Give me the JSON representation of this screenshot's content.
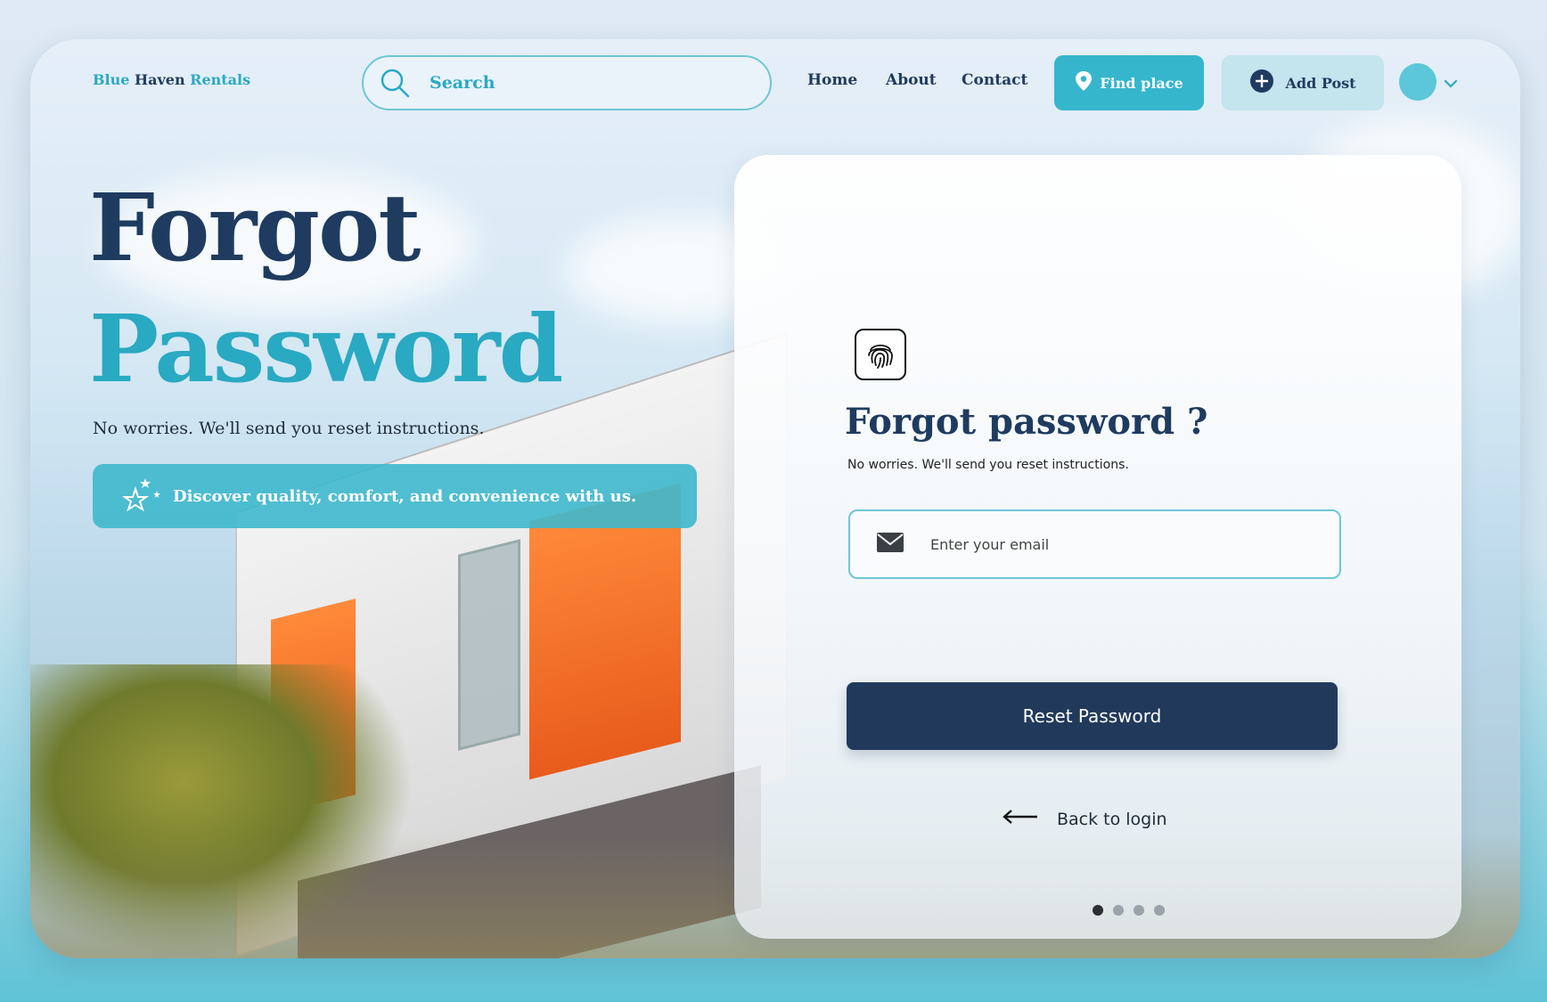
{
  "header": {
    "logo": {
      "part1": "Blue",
      "part2": "Haven",
      "part3": "Rentals"
    },
    "search": {
      "placeholder": "Search"
    },
    "nav": [
      "Home",
      "About",
      "Contact"
    ],
    "find_place_label": "Find place",
    "add_post_label": "Add Post"
  },
  "hero": {
    "title_line1": "Forgot",
    "title_line2": "Password",
    "subtitle": "No worries. We'll send you reset instructions.",
    "banner_text": "Discover quality, comfort, and convenience with us."
  },
  "card": {
    "title": "Forgot password ?",
    "subtitle": "No worries. We'll send you reset instructions.",
    "email_placeholder": "Enter your email",
    "reset_button": "Reset Password",
    "back_link": "Back to login",
    "pagination": {
      "total": 4,
      "active": 1
    }
  },
  "colors": {
    "navy": "#1f3b5f",
    "teal": "#2aa9c2",
    "button_navy": "#213a5c"
  },
  "icons": [
    "search-icon",
    "location-pin-icon",
    "plus-circle-icon",
    "chevron-down-icon",
    "stars-icon",
    "fingerprint-icon",
    "mail-icon",
    "arrow-left-icon"
  ]
}
